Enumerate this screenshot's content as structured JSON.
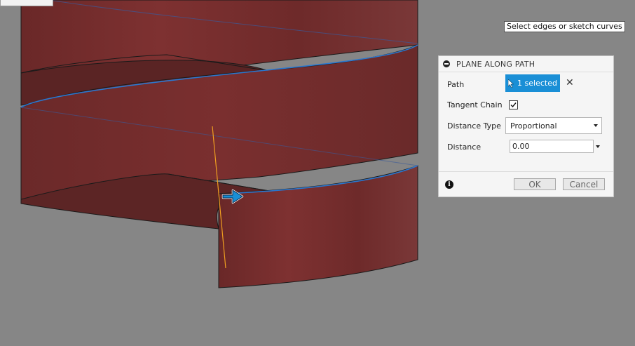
{
  "viewport": {
    "hint_text": "Select edges or sketch curves",
    "body_color": "#7a3030",
    "edge_highlight_color": "#2a78d0",
    "plane_line_color": "#f0a020",
    "background_color": "#868686"
  },
  "panel": {
    "title": "PLANE ALONG PATH",
    "path": {
      "label": "Path",
      "button_text": "1 selected"
    },
    "tangent_chain": {
      "label": "Tangent Chain",
      "checked": true
    },
    "distance_type": {
      "label": "Distance Type",
      "value": "Proportional"
    },
    "distance": {
      "label": "Distance",
      "value": "0.00"
    },
    "ok_label": "OK",
    "cancel_label": "Cancel"
  },
  "icons": {
    "collapse": "minus-circle-icon",
    "cursor": "pointer-cursor-icon",
    "clear": "close-icon",
    "checkbox": "checkmark-icon",
    "info": "info-icon",
    "manipulator": "arrow-manipulator-icon"
  }
}
